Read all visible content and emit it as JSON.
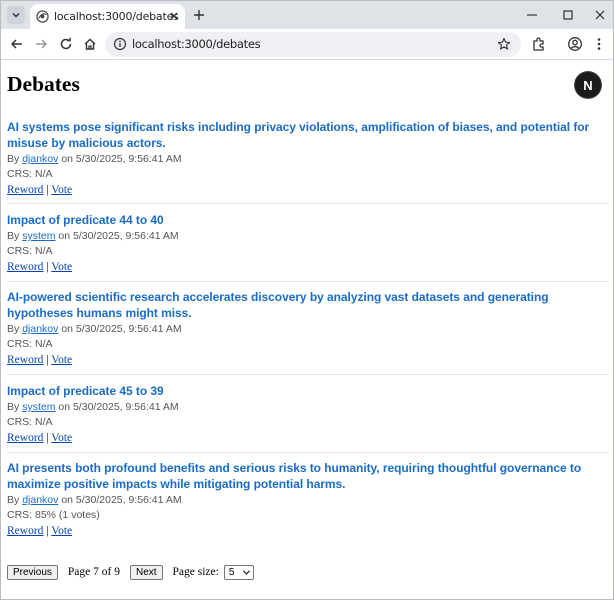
{
  "browser": {
    "tab_title": "localhost:3000/debates",
    "url": "localhost:3000/debates"
  },
  "page": {
    "title": "Debates",
    "badge": "N"
  },
  "debates": [
    {
      "title": "AI systems pose significant risks including privacy violations, amplification of biases, and potential for misuse by malicious actors.",
      "by_label": "By",
      "author": "djankov",
      "on_label": "on 5/30/2025, 9:56:41 AM",
      "crs": "CRS: N/A",
      "reword": "Reword",
      "sep": "|",
      "vote": "Vote"
    },
    {
      "title": "Impact of predicate 44 to 40",
      "by_label": "By",
      "author": "system",
      "on_label": "on 5/30/2025, 9:56:41 AM",
      "crs": "CRS: N/A",
      "reword": "Reword",
      "sep": "|",
      "vote": "Vote"
    },
    {
      "title": "AI-powered scientific research accelerates discovery by analyzing vast datasets and generating hypotheses humans might miss.",
      "by_label": "By",
      "author": "djankov",
      "on_label": "on 5/30/2025, 9:56:41 AM",
      "crs": "CRS: N/A",
      "reword": "Reword",
      "sep": "|",
      "vote": "Vote"
    },
    {
      "title": "Impact of predicate 45 to 39",
      "by_label": "By",
      "author": "system",
      "on_label": "on 5/30/2025, 9:56:41 AM",
      "crs": "CRS: N/A",
      "reword": "Reword",
      "sep": "|",
      "vote": "Vote"
    },
    {
      "title": "AI presents both profound benefits and serious risks to humanity, requiring thoughtful governance to maximize positive impacts while mitigating potential harms.",
      "by_label": "By",
      "author": "djankov",
      "on_label": "on 5/30/2025, 9:56:41 AM",
      "crs": "CRS: 85% (1 votes)",
      "reword": "Reword",
      "sep": "|",
      "vote": "Vote"
    }
  ],
  "pager": {
    "previous": "Previous",
    "page_info": "Page 7 of 9",
    "next": "Next",
    "size_label": "Page size:",
    "size_value": "5"
  },
  "icons": {
    "tab_menu": "chevron-down-icon",
    "favicon": "globe-icon",
    "close": "close-icon",
    "new_tab": "plus-icon",
    "back": "arrow-left-icon",
    "forward": "arrow-right-icon",
    "reload": "reload-icon",
    "home": "home-icon",
    "site_info": "info-icon",
    "bookmark": "star-icon",
    "extensions": "puzzle-icon",
    "profile": "account-icon",
    "menu": "kebab-menu-icon"
  }
}
